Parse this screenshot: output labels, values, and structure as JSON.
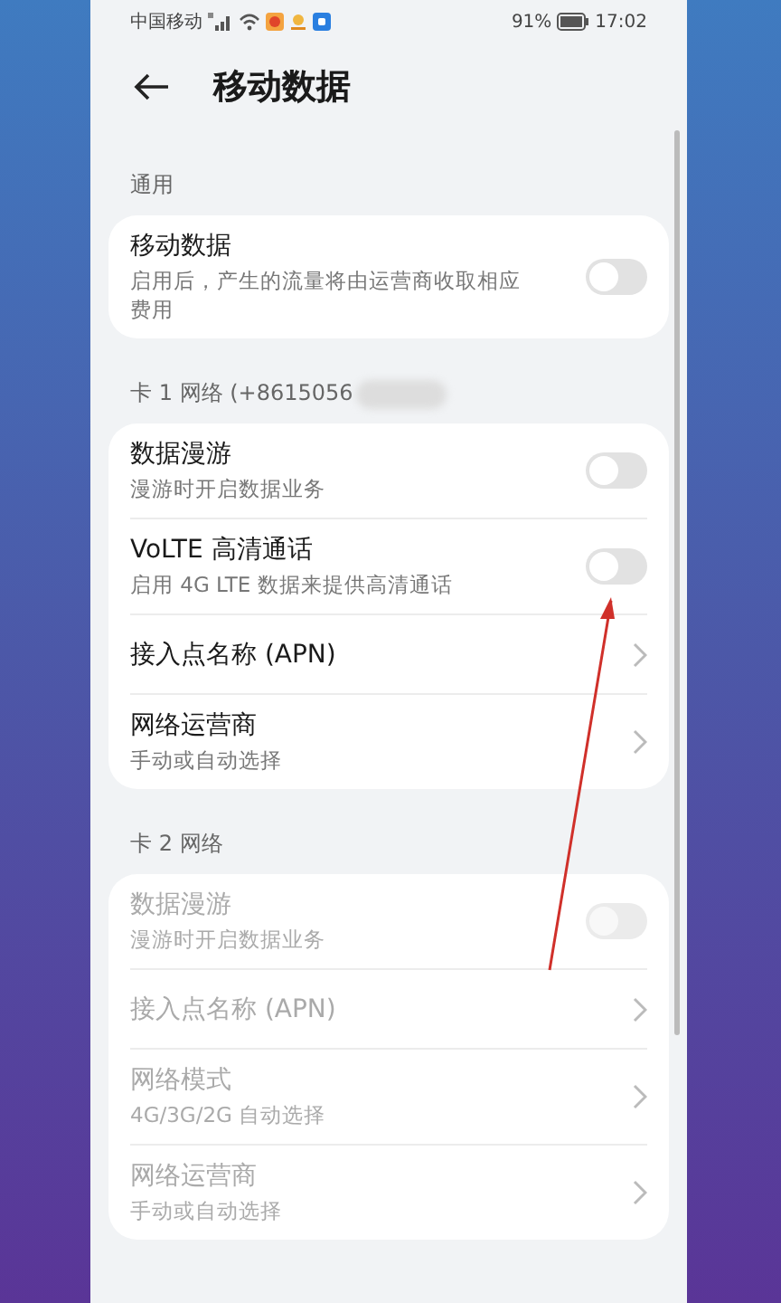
{
  "status_bar": {
    "carrier": "中国移动",
    "battery": "91%",
    "time": "17:02"
  },
  "header": {
    "title": "移动数据"
  },
  "sections": [
    {
      "title": "通用",
      "redacted": false,
      "rows": [
        {
          "kind": "toggle",
          "title": "移动数据",
          "subtitle": "启用后，产生的流量将由运营商收取相应费用",
          "on": false,
          "disabled": false
        }
      ]
    },
    {
      "title": "卡 1 网络 (+8615056",
      "redacted": true,
      "rows": [
        {
          "kind": "toggle",
          "title": "数据漫游",
          "subtitle": "漫游时开启数据业务",
          "on": false,
          "disabled": false
        },
        {
          "kind": "toggle",
          "title": "VoLTE 高清通话",
          "subtitle": "启用 4G LTE 数据来提供高清通话",
          "on": false,
          "disabled": false
        },
        {
          "kind": "link",
          "title": "接入点名称 (APN)",
          "disabled": false
        },
        {
          "kind": "link",
          "title": "网络运营商",
          "subtitle": "手动或自动选择",
          "disabled": false
        }
      ]
    },
    {
      "title": "卡 2 网络",
      "redacted": false,
      "rows": [
        {
          "kind": "toggle",
          "title": "数据漫游",
          "subtitle": "漫游时开启数据业务",
          "on": false,
          "disabled": true
        },
        {
          "kind": "link",
          "title": "接入点名称 (APN)",
          "disabled": true
        },
        {
          "kind": "link",
          "title": "网络模式",
          "subtitle": "4G/3G/2G 自动选择",
          "disabled": true
        },
        {
          "kind": "link",
          "title": "网络运营商",
          "subtitle": "手动或自动选择",
          "disabled": true
        }
      ]
    }
  ]
}
